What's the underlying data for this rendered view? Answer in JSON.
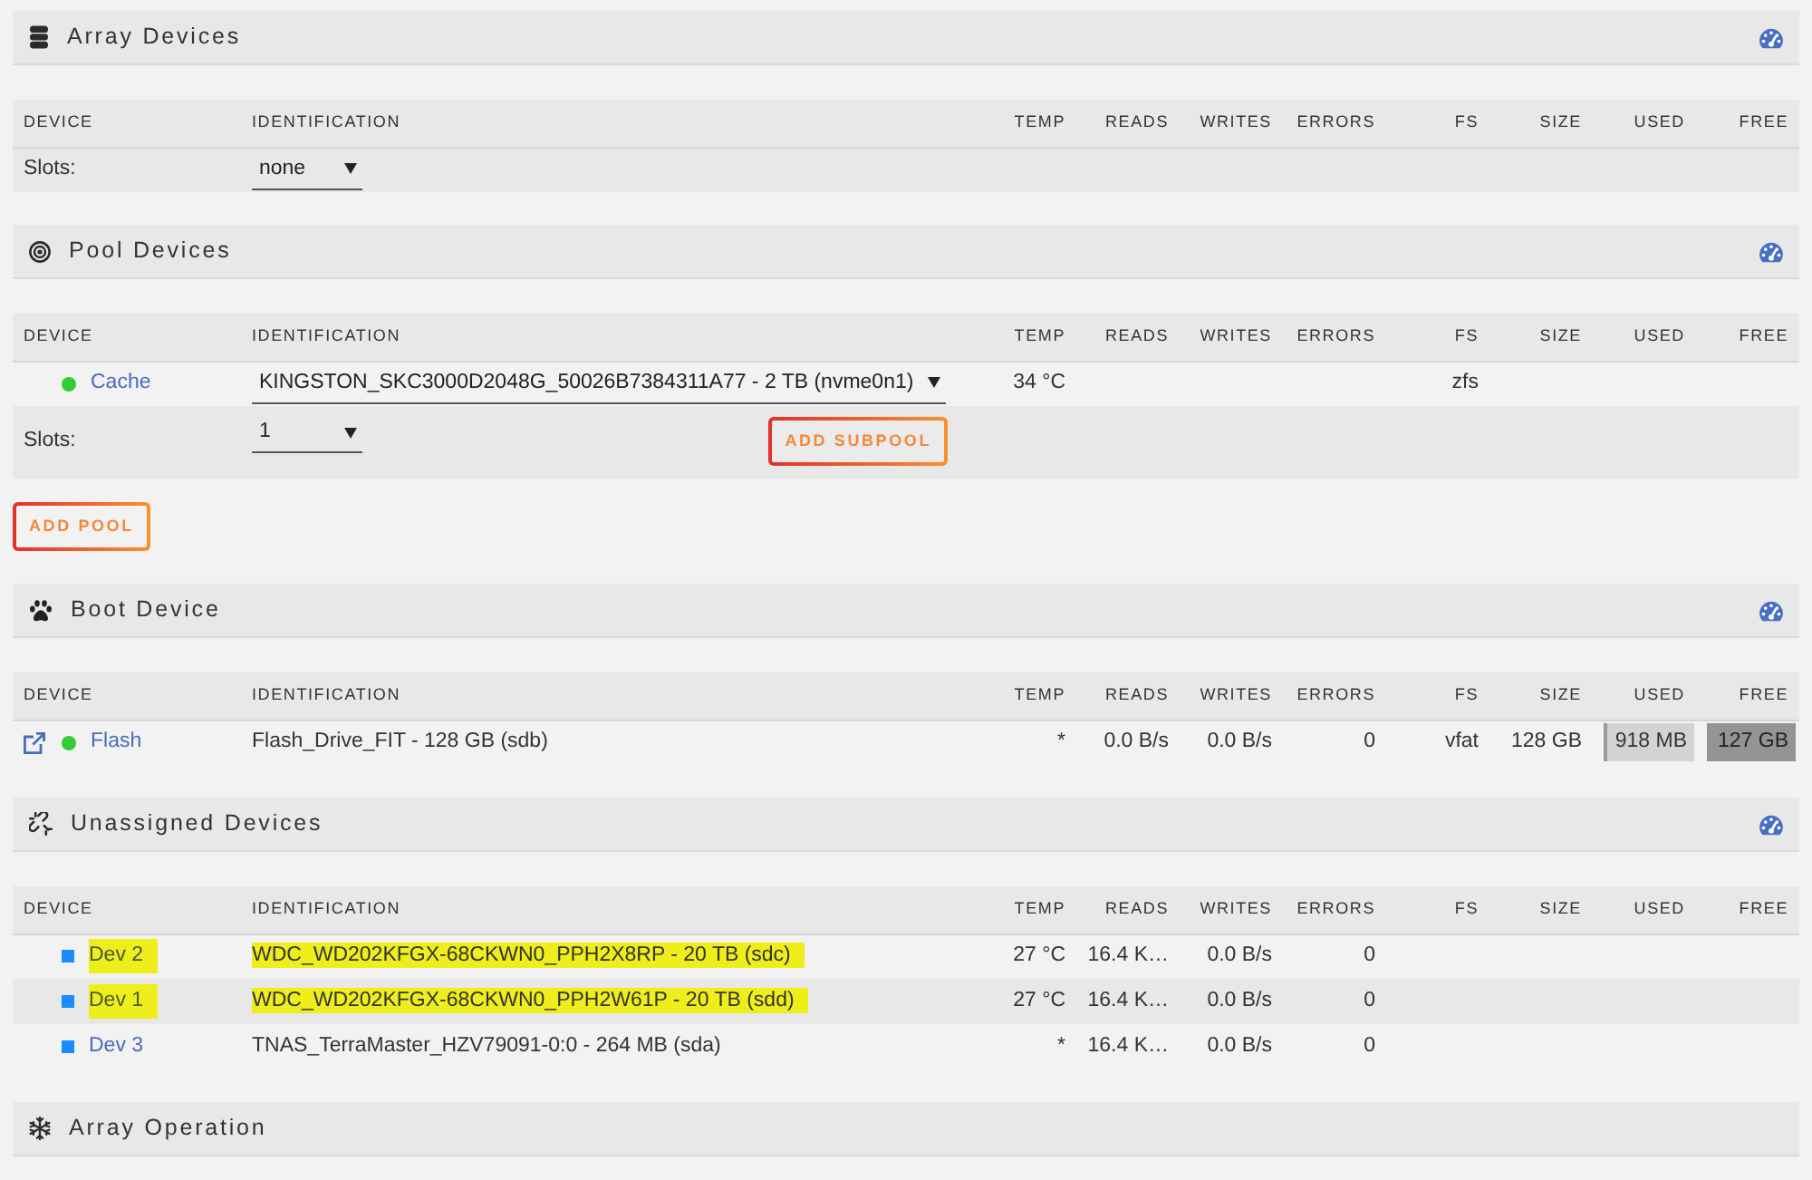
{
  "sections": [
    {
      "kind": "array",
      "title": "Array Devices",
      "gauge": true,
      "table": {
        "columns": [
          "DEVICE",
          "IDENTIFICATION",
          "TEMP",
          "READS",
          "WRITES",
          "ERRORS",
          "FS",
          "SIZE",
          "USED",
          "FREE"
        ],
        "rows": [
          {
            "kind": "slots",
            "label": "Slots:",
            "value": "none"
          }
        ]
      }
    },
    {
      "kind": "pool",
      "title": "Pool Devices",
      "gauge": true,
      "table": {
        "columns": [
          "DEVICE",
          "IDENTIFICATION",
          "TEMP",
          "READS",
          "WRITES",
          "ERRORS",
          "FS",
          "SIZE",
          "USED",
          "FREE"
        ],
        "rows": [
          {
            "kind": "device",
            "external_link": false,
            "assigned": true,
            "color": "#33cc33",
            "name": "Cache",
            "highlighted": false,
            "dropdown": true,
            "identification": "KINGSTON_SKC3000D2048G_50026B7384311A77 - 2 TB (nvme0n1)",
            "temp": "34 °C",
            "fs": "zfs"
          },
          {
            "kind": "slots",
            "label": "Slots:",
            "value": "1",
            "button": "ADD SUBPOOL"
          }
        ]
      },
      "buttons": [
        "ADD POOL"
      ]
    },
    {
      "kind": "boot",
      "title": "Boot Device",
      "gauge": true,
      "table": {
        "columns": [
          "DEVICE",
          "IDENTIFICATION",
          "TEMP",
          "READS",
          "WRITES",
          "ERRORS",
          "FS",
          "SIZE",
          "USED",
          "FREE"
        ],
        "rows": [
          {
            "kind": "device",
            "external_link": true,
            "assigned": true,
            "color": "#33cc33",
            "name": "Flash",
            "highlighted": false,
            "dropdown": false,
            "identification": "Flash_Drive_FIT - 128 GB (sdb)",
            "temp": "*",
            "reads": "0.0 B/s",
            "writes": "0.0 B/s",
            "errors": "0",
            "fs": "vfat",
            "size": "128 GB",
            "used": "918 MB",
            "free": "127 GB"
          }
        ]
      }
    },
    {
      "kind": "unassigned",
      "title": "Unassigned Devices",
      "gauge": true,
      "table": {
        "columns": [
          "DEVICE",
          "IDENTIFICATION",
          "TEMP",
          "READS",
          "WRITES",
          "ERRORS",
          "FS",
          "SIZE",
          "USED",
          "FREE"
        ],
        "rows": [
          {
            "kind": "device",
            "external_link": false,
            "assigned": false,
            "color": "#1a8cff",
            "name": "Dev 2",
            "highlighted": true,
            "dropdown": false,
            "identification": "WDC_WD202KFGX-68CKWN0_PPH2X8RP - 20 TB (sdc)",
            "temp": "27 °C",
            "reads": "16.4 K…",
            "writes": "0.0 B/s",
            "errors": "0"
          },
          {
            "kind": "device",
            "external_link": false,
            "assigned": false,
            "color": "#1a8cff",
            "name": "Dev 1",
            "highlighted": true,
            "dropdown": false,
            "identification": "WDC_WD202KFGX-68CKWN0_PPH2W61P - 20 TB (sdd)",
            "temp": "27 °C",
            "reads": "16.4 K…",
            "writes": "0.0 B/s",
            "errors": "0"
          },
          {
            "kind": "device",
            "external_link": false,
            "assigned": false,
            "color": "#1a8cff",
            "name": "Dev 3",
            "highlighted": false,
            "dropdown": false,
            "identification": "TNAS_TerraMaster_HZV79091-0:0 - 264 MB (sda)",
            "temp": "*",
            "reads": "16.4 K…",
            "writes": "0.0 B/s",
            "errors": "0"
          }
        ]
      }
    },
    {
      "kind": "operation",
      "title": "Array Operation",
      "gauge": false
    }
  ]
}
